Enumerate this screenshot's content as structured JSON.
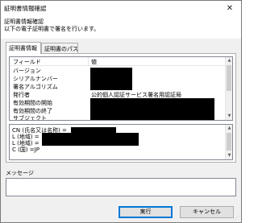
{
  "window": {
    "title": "証明書情報確認",
    "close_glyph": "✕"
  },
  "header": {
    "title": "証明書情報確認",
    "description": "以下の電子証明書で署名を行います。"
  },
  "tabs": [
    {
      "label": "証明書情報",
      "active": true
    },
    {
      "label": "証明書のパス",
      "active": false
    }
  ],
  "fields_table": {
    "columns": [
      "フィールド",
      "値"
    ],
    "rows": [
      {
        "field": "バージョン",
        "value": "",
        "redacted": true
      },
      {
        "field": "シリアルナンバー",
        "value": "",
        "redacted": true
      },
      {
        "field": "署名アルゴリズム",
        "value": "",
        "redacted": true
      },
      {
        "field": "発行者",
        "value": "公的個人認証サービス署名用認証局",
        "redacted": false
      },
      {
        "field": "有効期間の開始",
        "value": "",
        "redacted": true
      },
      {
        "field": "有効期間の終了",
        "value": "",
        "redacted": true
      },
      {
        "field": "サブジェクト",
        "value": "",
        "redacted": true
      }
    ]
  },
  "detail": {
    "lines": [
      "CN (氏名又は名称) =",
      "L (地域) =",
      "L (地域) =",
      "C (国) =JP"
    ]
  },
  "message": {
    "label": "メッセージ",
    "value": ""
  },
  "buttons": {
    "ok": "実行",
    "cancel": "キャンセル"
  },
  "icons": {
    "scroll_up": "scroll-up-arrow-icon",
    "scroll_down": "scroll-down-arrow-icon",
    "close": "close-icon",
    "resize": "resize-grip-icon"
  }
}
